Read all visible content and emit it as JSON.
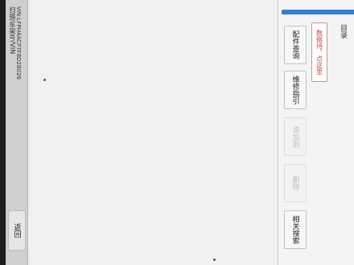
{
  "left_strip": {
    "scan_label": "扫描/车架号/VIN",
    "vin_label": "VIN:LFPH4ACP7F8D2B026",
    "back_label": "返回"
  },
  "right_panel": {
    "title": "目录",
    "hint": "数据待，点这里",
    "buttons": [
      {
        "label": "配件查询",
        "enabled": true
      },
      {
        "label": "维修指引",
        "enabled": true
      },
      {
        "label": "添加到",
        "enabled": false
      },
      {
        "label": "删除",
        "enabled": false
      },
      {
        "label": "相关搜索",
        "enabled": true
      }
    ]
  },
  "colors": {
    "accent": "#3a7bd5",
    "hint_text": "#d04040",
    "disabled_text": "#bdbdbd"
  }
}
